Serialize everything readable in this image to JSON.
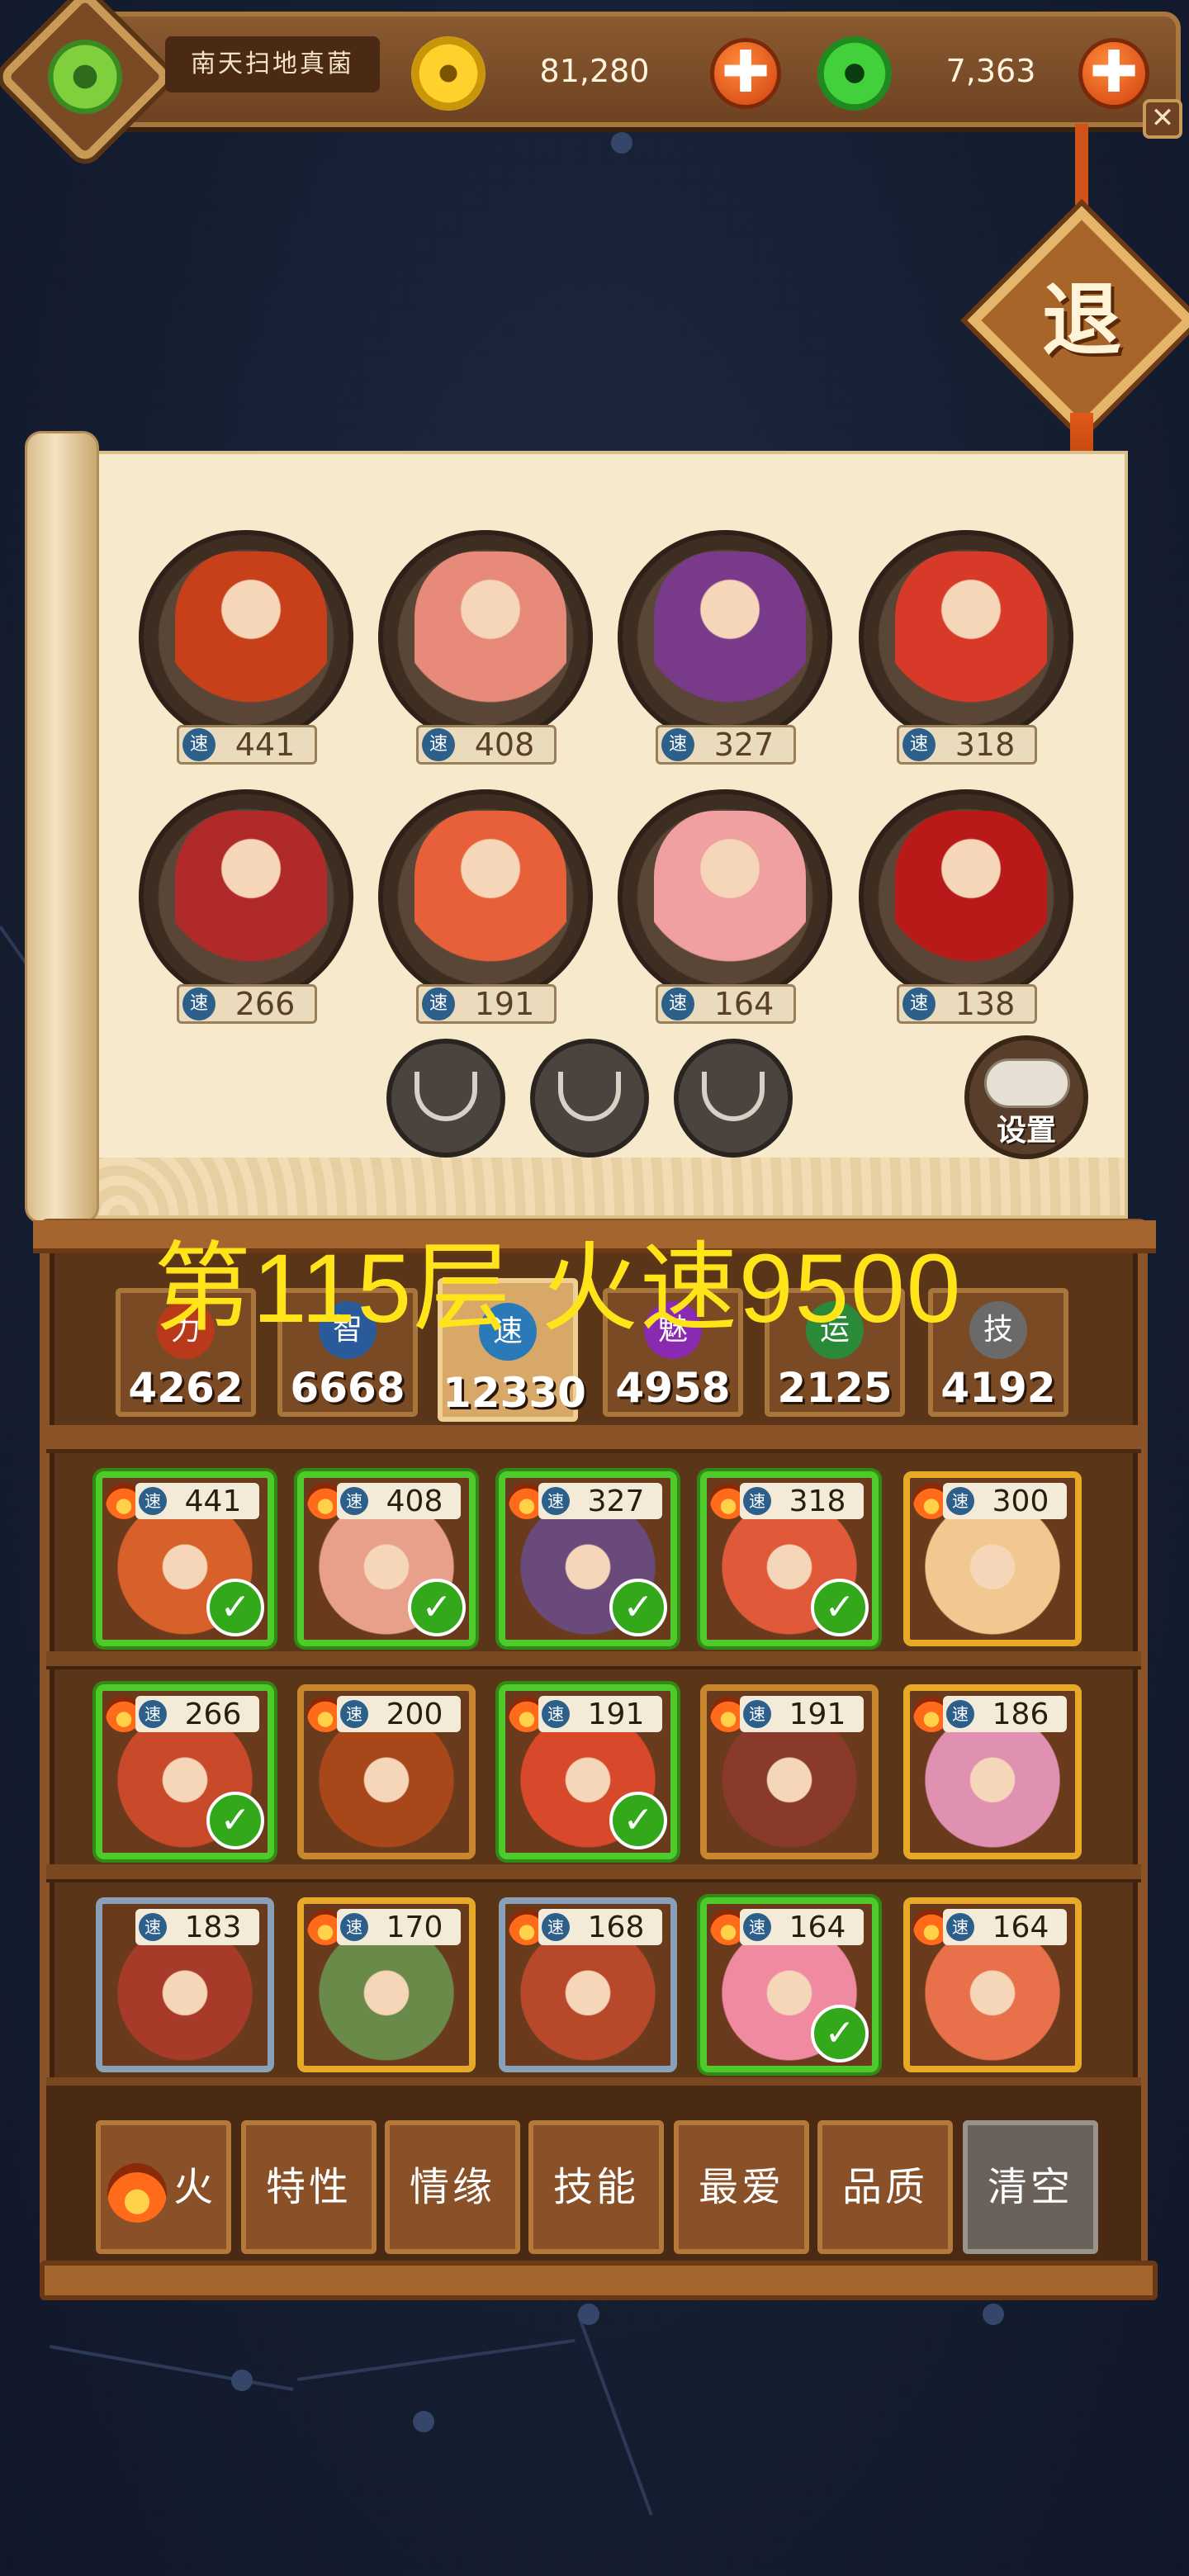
{
  "header": {
    "player_name": "南天扫地真菌",
    "gold": "81,280",
    "jade": "7,363",
    "plus_label": "✚",
    "close_label": "✕",
    "avatar_icon": "jade-coin-icon"
  },
  "exit_label": "退",
  "team": {
    "speed_glyph": "速",
    "members": [
      {
        "speed": "441",
        "color": "#c8401a"
      },
      {
        "speed": "408",
        "color": "#e88a7a"
      },
      {
        "speed": "327",
        "color": "#7a3a8a"
      },
      {
        "speed": "318",
        "color": "#d83a2a"
      },
      {
        "speed": "266",
        "color": "#b02a2a"
      },
      {
        "speed": "191",
        "color": "#e8603a"
      },
      {
        "speed": "164",
        "color": "#f0a0a0"
      },
      {
        "speed": "138",
        "color": "#b81a1a"
      }
    ],
    "empty_slots": 3,
    "settings_label": "设置"
  },
  "floor_title": "第115层 火速9500",
  "stat_tabs": [
    {
      "icon": "力",
      "value": "4262",
      "color": "#b83a1a",
      "active": false
    },
    {
      "icon": "智",
      "value": "6668",
      "color": "#2a5a9a",
      "active": false
    },
    {
      "icon": "速",
      "value": "12330",
      "color": "#2a7ab8",
      "active": true
    },
    {
      "icon": "魅",
      "value": "4958",
      "color": "#8a2ab0",
      "active": false
    },
    {
      "icon": "运",
      "value": "2125",
      "color": "#2a8a3a",
      "active": false
    },
    {
      "icon": "技",
      "value": "4192",
      "color": "#6a6a6a",
      "active": false
    }
  ],
  "heroes": [
    {
      "speed": "441",
      "fire": true,
      "selected": true,
      "frame": "#c8862e",
      "color": "#d8602a"
    },
    {
      "speed": "408",
      "fire": true,
      "selected": true,
      "frame": "#c8862e",
      "color": "#e8a08a"
    },
    {
      "speed": "327",
      "fire": true,
      "selected": true,
      "frame": "#c8862e",
      "color": "#6a4a7a"
    },
    {
      "speed": "318",
      "fire": true,
      "selected": true,
      "frame": "#c8862e",
      "color": "#e05a3a"
    },
    {
      "speed": "300",
      "fire": true,
      "selected": false,
      "frame": "#e8a828",
      "color": "#f0c890"
    },
    {
      "speed": "266",
      "fire": true,
      "selected": true,
      "frame": "#c8862e",
      "color": "#c84a2a"
    },
    {
      "speed": "200",
      "fire": true,
      "selected": false,
      "frame": "#c8862e",
      "color": "#a8481a"
    },
    {
      "speed": "191",
      "fire": true,
      "selected": true,
      "frame": "#c8862e",
      "color": "#d8482a"
    },
    {
      "speed": "191",
      "fire": true,
      "selected": false,
      "frame": "#c8862e",
      "color": "#8a3a2a"
    },
    {
      "speed": "186",
      "fire": true,
      "selected": false,
      "frame": "#e8a828",
      "color": "#e090b0"
    },
    {
      "speed": "183",
      "fire": false,
      "selected": false,
      "frame": "#8aa0b8",
      "color": "#a83a2a"
    },
    {
      "speed": "170",
      "fire": true,
      "selected": false,
      "frame": "#e8a828",
      "color": "#6a8a4a"
    },
    {
      "speed": "168",
      "fire": true,
      "selected": false,
      "frame": "#8aa0b8",
      "color": "#b8482a"
    },
    {
      "speed": "164",
      "fire": true,
      "selected": true,
      "frame": "#c8862e",
      "color": "#f08aa0"
    },
    {
      "speed": "164",
      "fire": true,
      "selected": false,
      "frame": "#e8a828",
      "color": "#e8704a"
    }
  ],
  "check_mark": "✓",
  "filters": [
    {
      "label": "火",
      "type": "fire"
    },
    {
      "label": "特性",
      "type": "normal"
    },
    {
      "label": "情缘",
      "type": "normal"
    },
    {
      "label": "技能",
      "type": "normal"
    },
    {
      "label": "最爱",
      "type": "normal"
    },
    {
      "label": "品质",
      "type": "normal"
    },
    {
      "label": "清空",
      "type": "gray"
    }
  ]
}
